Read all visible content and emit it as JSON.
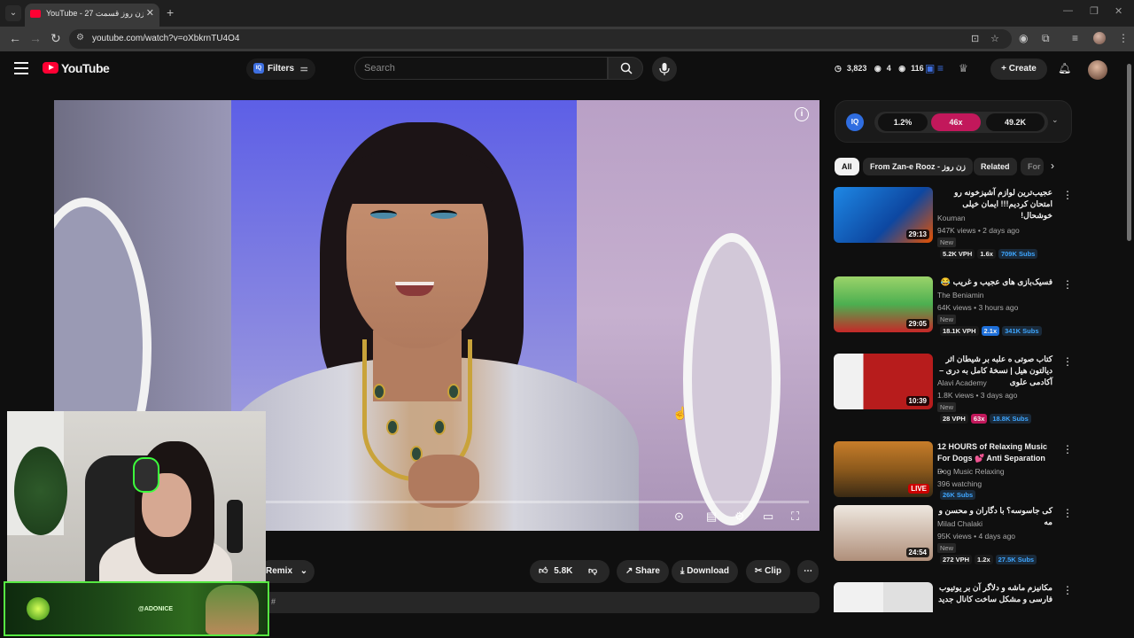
{
  "browser": {
    "tab_title": "YouTube - زن روز قسمت 27",
    "url": "youtube.com/watch?v=oXbkrnTU4O4"
  },
  "masthead": {
    "logo_text": "YouTube",
    "filters_label": "Filters",
    "iq_badge": "IQ",
    "search_placeholder": "Search",
    "stats": [
      "3,823",
      "4",
      "116"
    ],
    "create_label": "Create"
  },
  "player": {
    "info_icon": "i",
    "progress": 0
  },
  "actions": {
    "remix": "Remix",
    "likes": "5.8K",
    "share": "Share",
    "download": "Download",
    "clip": "Clip",
    "more": "⋯",
    "description_snippet": "#"
  },
  "overlay": {
    "handle": "@ADONICE"
  },
  "iq_panel": {
    "logo": "IQ",
    "segments": [
      "1.2%",
      "46x",
      "49.2K"
    ]
  },
  "chips": [
    "All",
    "From Zan-e Rooz - زن روز",
    "Related",
    "For"
  ],
  "videos": [
    {
      "title": "عجیب‌ترین لوازم آشپزخونه رو امتحان کردیم!!! ایمان خیلی خوشحال!",
      "channel": "Kouman",
      "meta": "947K views • 2 days ago",
      "new": "New",
      "duration": "29:13",
      "stats": [
        "5.2K VPH",
        "1.6x",
        "709K Subs"
      ],
      "rtl": true
    },
    {
      "title": "فسیک‌بازی های عجیب و غریب 😂",
      "channel": "The Beniamin",
      "meta": "64K views • 3 hours ago",
      "new": "New",
      "duration": "29:05",
      "stats": [
        "18.1K VPH",
        "2.1x",
        "341K Subs"
      ],
      "rtl": true
    },
    {
      "title": "کتاب صوتی ه علبه بر شیطان اثر دیالتون هیل | نسخهٔ کامل به دری – آکادمی علوی",
      "channel": "Alavi Academy",
      "meta": "1.8K views • 3 days ago",
      "new": "New",
      "duration": "10:39",
      "stats": [
        "28 VPH",
        "63x",
        "18.8K Subs"
      ],
      "rtl": true
    },
    {
      "title": "12 HOURS of Relaxing Music For Dogs 💕 Anti Separation ...",
      "channel": "Dog Music Relaxing",
      "meta": "396 watching",
      "live": "LIVE",
      "stats": [
        "26K Subs"
      ],
      "rtl": false
    },
    {
      "title": "کی جاسوسه؟ با دگاران و محسن و مه",
      "channel": "Milad Chalaki",
      "meta": "95K views • 4 days ago",
      "new": "New",
      "duration": "24:54",
      "stats": [
        "272 VPH",
        "1.2x",
        "27.5K Subs"
      ],
      "rtl": true
    },
    {
      "title": "مکانیزم ماشه و دلاگر آن بر یوتیوب فارسی و مشکل ساخت کانال جدید",
      "rtl": true
    }
  ],
  "colors": {
    "yt_red": "#ff0033",
    "iq_blue": "#2f6de0",
    "iq_pink": "#c2185b",
    "vph_blue": "#3ea6ff"
  }
}
